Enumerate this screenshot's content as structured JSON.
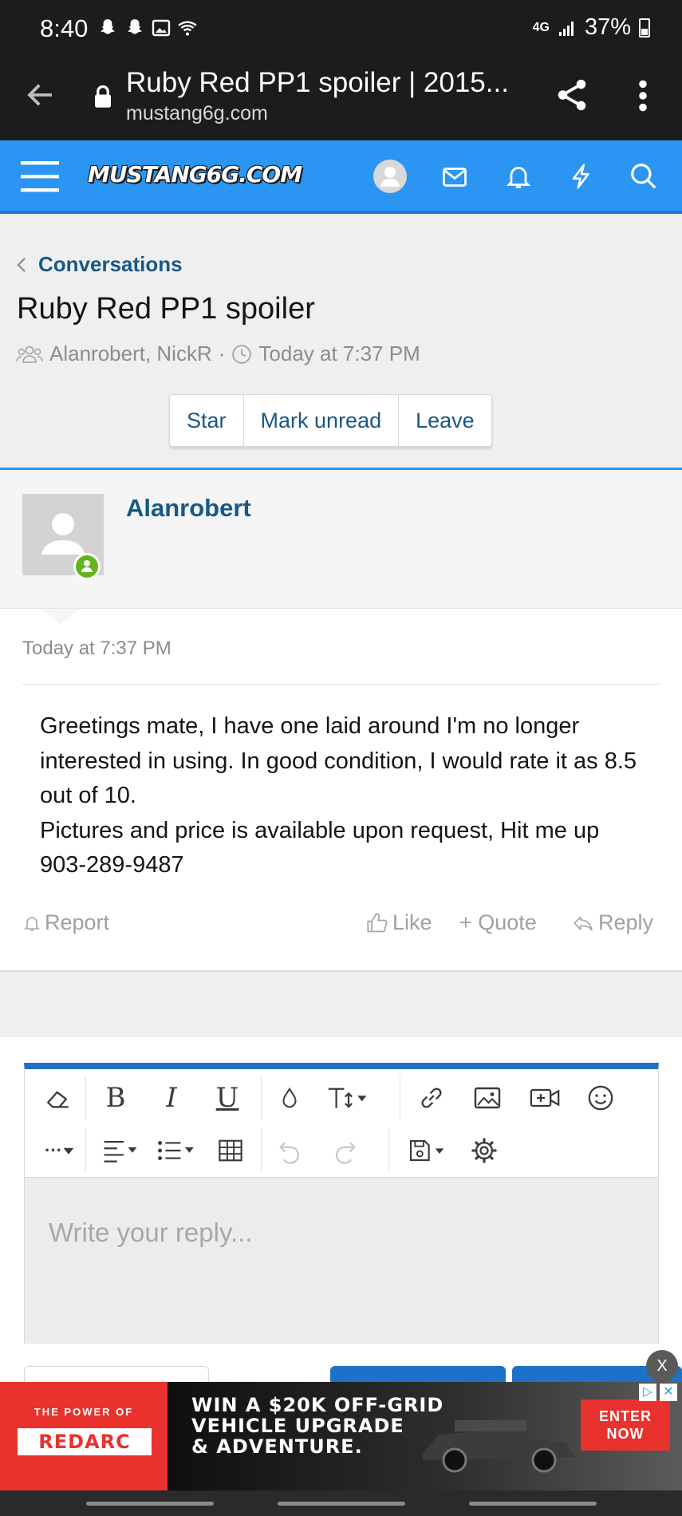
{
  "status_bar": {
    "time": "8:40",
    "network": "4G",
    "battery": "37%"
  },
  "browser": {
    "page_title": "Ruby Red PP1 spoiler | 2015...",
    "domain": "mustang6g.com"
  },
  "site_header": {
    "logo_text": "MUSTANG6G.COM",
    "background_color": "#2a95f3"
  },
  "breadcrumb": {
    "label": "Conversations"
  },
  "conversation": {
    "title": "Ruby Red PP1 spoiler",
    "participants": "Alanrobert, NickR",
    "separator": "·",
    "started": "Today at 7:37 PM",
    "buttons": {
      "star": "Star",
      "mark_unread": "Mark unread",
      "leave": "Leave"
    }
  },
  "message": {
    "author": "Alanrobert",
    "date": "Today at 7:37 PM",
    "body_line1": "Greetings mate, I have one laid around I'm no longer interested in using. In good condition, I would rate it as 8.5 out of 10.",
    "body_line2": "Pictures and price is available upon request, Hit me up 903-289-9487",
    "actions": {
      "report": "Report",
      "like": "Like",
      "quote": "+ Quote",
      "reply": "Reply"
    }
  },
  "editor": {
    "placeholder": "Write your reply...",
    "accent_color": "#1d71c6",
    "toolbar_row1_icons": [
      "eraser-icon",
      "bold-icon",
      "italic-icon",
      "underline-icon",
      "color-drop-icon",
      "font-size-icon",
      "link-icon",
      "image-icon",
      "video-icon",
      "smiley-icon"
    ],
    "toolbar_row2_icons": [
      "more-icon",
      "align-icon",
      "list-icon",
      "table-icon",
      "undo-icon",
      "redo-icon",
      "save-draft-icon",
      "settings-icon"
    ],
    "bold_glyph": "B",
    "italic_glyph": "I",
    "underline_glyph": "U",
    "more_glyph": "···"
  },
  "ad": {
    "tagline": "THE POWER OF",
    "brand": "REDARC",
    "headline_1": "WIN A $20K OFF-GRID",
    "headline_2": "VEHICLE UPGRADE",
    "headline_3": "& ADVENTURE.",
    "cta_1": "ENTER",
    "cta_2": "NOW",
    "close": "X"
  }
}
